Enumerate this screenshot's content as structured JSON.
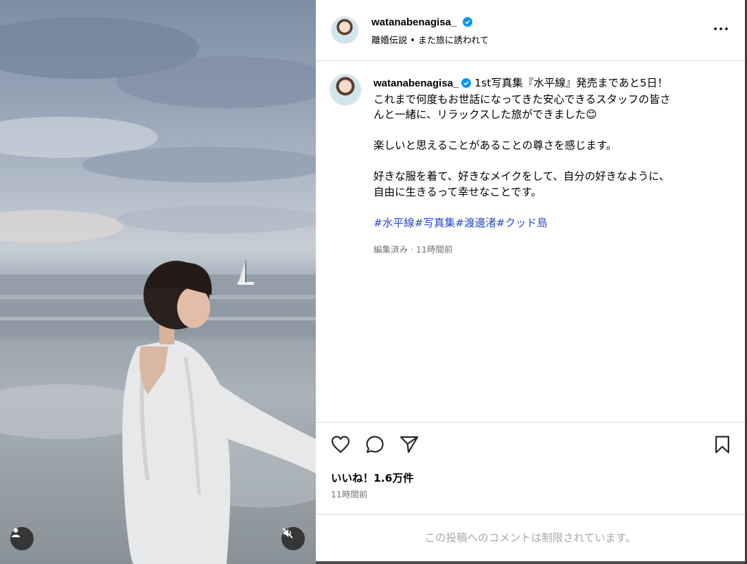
{
  "post": {
    "username": "watanabenagisa_",
    "location": "離婚伝説 • また旅に誘われて",
    "caption_line1": "1st写真集『水平線』発売まであと5日！",
    "caption_line2": "これまで何度もお世話になってきた安心できるスタッフの皆さ",
    "caption_line3": "んと一緒に、リラックスした旅ができました😊",
    "caption_p2": "楽しいと思えることがあることの尊さを感じます。",
    "caption_p3_line1": "好きな服を着て、好きなメイクをして、自分の好きなように、",
    "caption_p3_line2": "自由に生きるって幸せなことです。",
    "hashtags": [
      "#水平線",
      "#写真集",
      "#渡邊渚",
      "#クッド島"
    ],
    "edited_meta": "編集済み · 11時間前",
    "likes": "いいね！1.6万件",
    "timestamp": "11時間前",
    "comments_disabled": "この投稿へのコメントは制限されています。"
  },
  "icons": {
    "verified": "verified-badge-icon",
    "more": "more-options-icon",
    "like": "heart-icon",
    "comment": "comment-bubble-icon",
    "share": "paper-plane-icon",
    "save": "bookmark-icon",
    "user_tags": "user-tag-icon",
    "audio": "muted-speaker-icon"
  },
  "colors": {
    "verified": "#0095f6",
    "hashtag": "#2a4bc7",
    "secondary_text": "#737373",
    "disabled_text": "#a8a8a8"
  }
}
